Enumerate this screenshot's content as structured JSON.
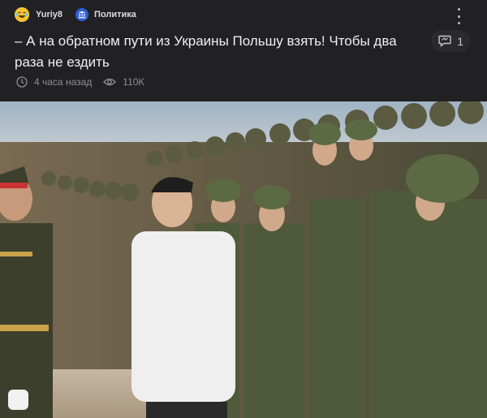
{
  "post": {
    "author": "Yuriy8",
    "category": "Политика",
    "title": "– А на обратном пути из Украины Польшу взять! Чтобы два раза не ездить",
    "comments_count": "1",
    "time": "4 часа назад",
    "views": "110K"
  },
  "icons": {
    "avatar": "laughing-emoji-avatar",
    "category": "government-building-icon",
    "comments": "comment-bubble-icon",
    "time": "clock-icon",
    "views": "eye-icon",
    "menu": "more-vertical-icon"
  },
  "colors": {
    "background": "#212124",
    "text": "#efeff1",
    "muted": "#8e8e93",
    "category_badge": "#2f5fd6",
    "avatar": "#f2c230"
  }
}
